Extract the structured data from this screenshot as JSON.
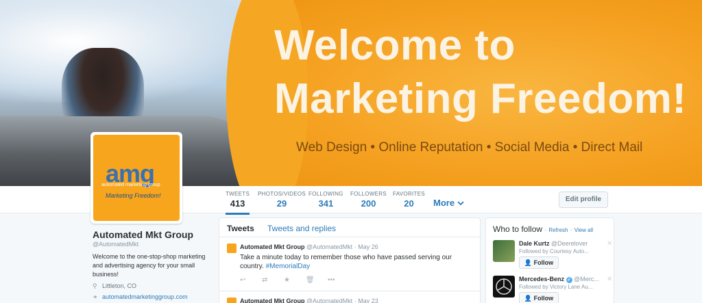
{
  "banner": {
    "title_line1": "Welcome to",
    "title_line2": "Marketing Freedom!",
    "subtitle": "Web Design • Online Reputation • Social Media • Direct Mail"
  },
  "avatar": {
    "logo_text": "amg",
    "logo_sub": "automated marketing group",
    "logo_tag": "Marketing Freedom!"
  },
  "stats": [
    {
      "label": "TWEETS",
      "value": "413"
    },
    {
      "label": "PHOTOS/VIDEOS",
      "value": "29"
    },
    {
      "label": "FOLLOWING",
      "value": "341"
    },
    {
      "label": "FOLLOWERS",
      "value": "200"
    },
    {
      "label": "FAVORITES",
      "value": "20"
    }
  ],
  "nav": {
    "more_label": "More",
    "edit_profile": "Edit profile"
  },
  "profile": {
    "name": "Automated Mkt Group",
    "handle": "@AutomatedMkt",
    "bio": "Welcome to the one-stop-shop marketing and advertising agency for your small business!",
    "location": "Littleton, CO",
    "url": "automatedmarketinggroup.com"
  },
  "timeline": {
    "tabs": [
      "Tweets",
      "Tweets and replies"
    ],
    "tweets": [
      {
        "name": "Automated Mkt Group",
        "handle": "@AutomatedMkt",
        "date": "May 26",
        "text": "Take a minute today to remember those who have passed serving our country.",
        "hashtag": "#MemorialDay"
      },
      {
        "name": "Automated Mkt Group",
        "handle": "@AutomatedMkt",
        "date": "May 23",
        "text": "",
        "hashtag": ""
      }
    ]
  },
  "who_to_follow": {
    "title": "Who to follow",
    "refresh": "Refresh",
    "view_all": "View all",
    "suggestions": [
      {
        "name": "Dale Kurtz",
        "handle": "@Deerelover",
        "followed_by": "Followed by Courtesy Auto...",
        "button": "Follow"
      },
      {
        "name": "Mercedes-Benz",
        "handle": "@Merc...",
        "followed_by": "Followed by Victory Lane Au...",
        "button": "Follow"
      }
    ]
  },
  "colors": {
    "accent": "#2b7bb9",
    "banner_orange": "#f5a623"
  }
}
